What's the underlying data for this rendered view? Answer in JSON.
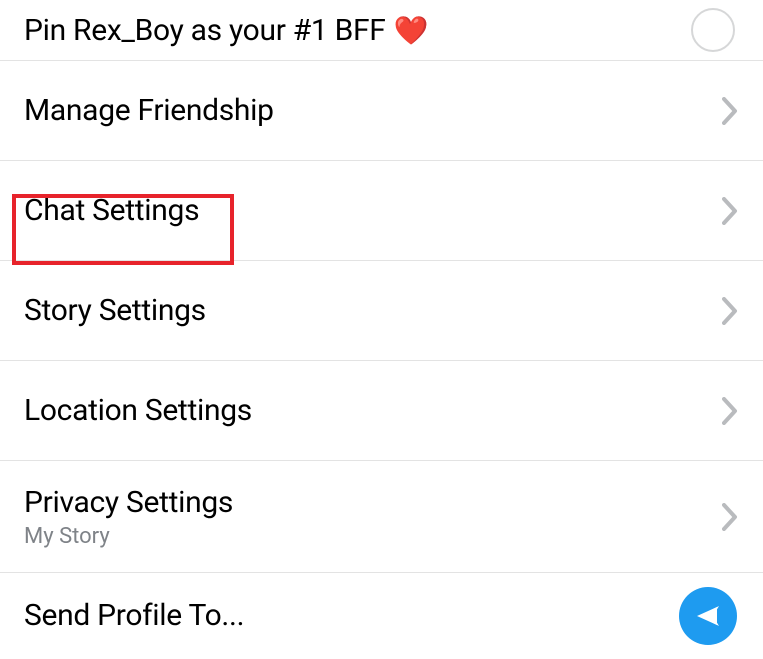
{
  "pin": {
    "label": "Pin Rex_Boy as your #1 BFF",
    "heart": "❤️"
  },
  "rows": {
    "manage_friendship": "Manage Friendship",
    "chat_settings": "Chat Settings",
    "story_settings": "Story Settings",
    "location_settings": "Location Settings",
    "privacy_settings": {
      "label": "Privacy Settings",
      "sublabel": "My Story"
    },
    "send_profile": "Send Profile To..."
  }
}
